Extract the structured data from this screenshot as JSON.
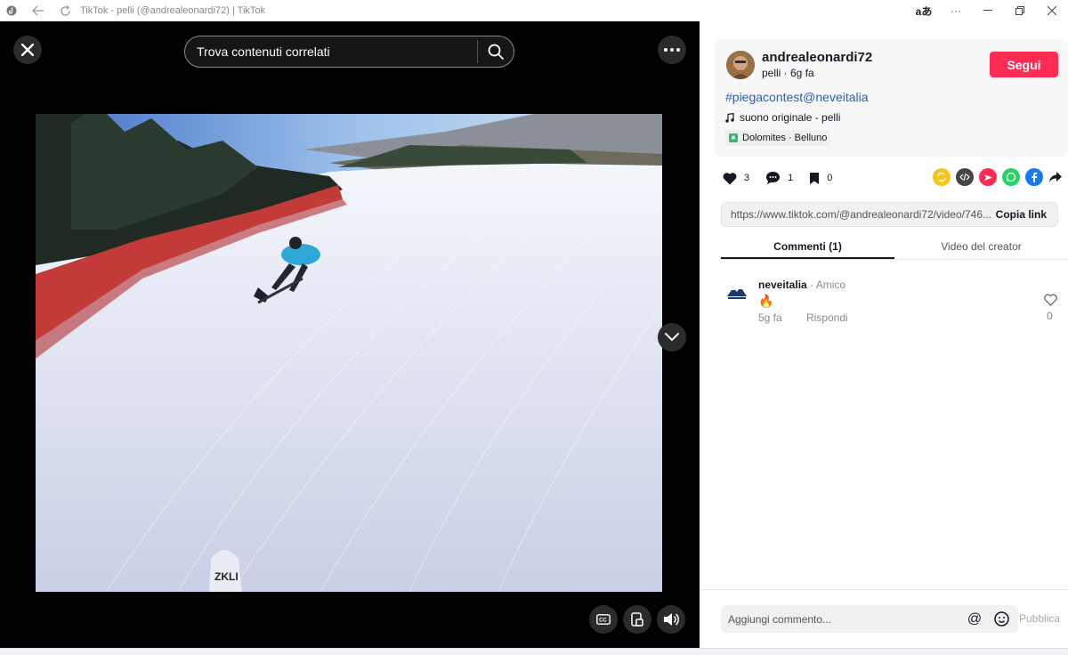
{
  "window": {
    "title": "TikTok - pelli (@andrealeonardi72) | TikTok",
    "lang_button": "aあ",
    "more_button": "···"
  },
  "player": {
    "search_placeholder": "Trova contenuti correlati"
  },
  "post": {
    "username": "andrealeonardi72",
    "meta": "pelli · 6g fa",
    "follow_label": "Segui",
    "hashtags": "#piegacontest@neveitalia",
    "music": "suono originale - pelli",
    "location": "Dolomites · Belluno"
  },
  "stats": {
    "likes": "3",
    "comments": "1",
    "saves": "0"
  },
  "share": {
    "url": "https://www.tiktok.com/@andrealeonardi72/video/746...",
    "copy_label": "Copia link",
    "icons": [
      "repost-icon",
      "embed-icon",
      "send-icon",
      "whatsapp-icon",
      "facebook-icon",
      "share-arrow-icon"
    ]
  },
  "tabs": [
    {
      "label": "Commenti (1)",
      "active": true
    },
    {
      "label": "Video del creator",
      "active": false
    }
  ],
  "comments": [
    {
      "user": "neveitalia",
      "tag": " · Amico",
      "text": "🔥",
      "date": "5g fa",
      "reply_label": "Rispondi",
      "likes": "0"
    }
  ],
  "composer": {
    "placeholder": "Aggiungi commento...",
    "publish_label": "Pubblica"
  },
  "colors": {
    "accent": "#fe2c55",
    "hashtag": "#2b5db9"
  }
}
